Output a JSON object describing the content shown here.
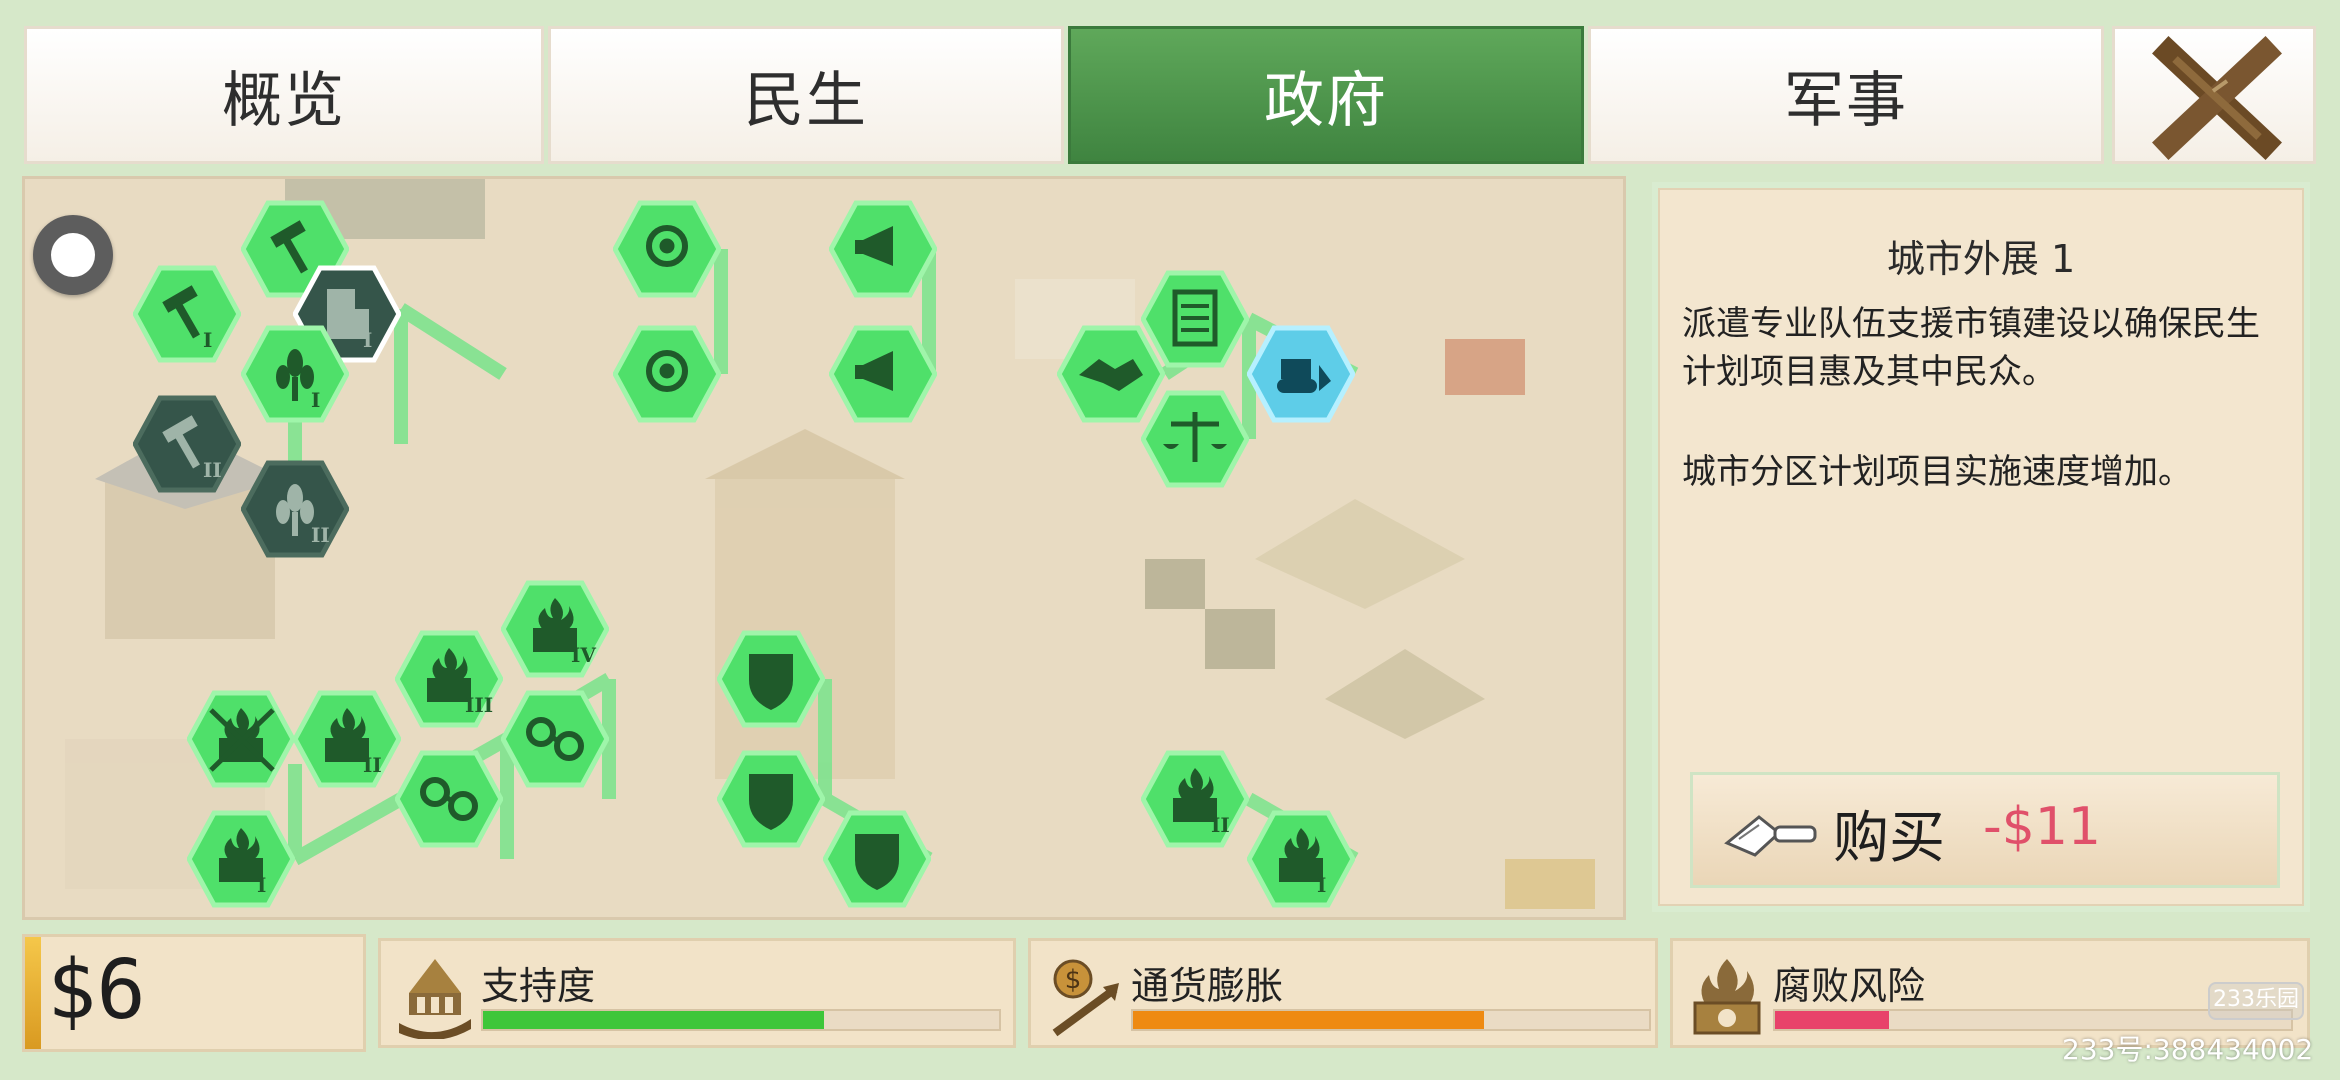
{
  "tabs": [
    {
      "label": "概览",
      "active": false
    },
    {
      "label": "民生",
      "active": false
    },
    {
      "label": "政府",
      "active": true
    },
    {
      "label": "军事",
      "active": false
    }
  ],
  "colors": {
    "active_tab": "#4a944a",
    "node_unlocked": "#4fe06a",
    "node_locked": "#35554a",
    "node_selected": "#5ecde8",
    "support_bar": "#3ec63a",
    "inflation_bar": "#ee8a12",
    "corruption_bar": "#e8426a",
    "price": "#e0506a"
  },
  "tech_nodes": [
    {
      "icon": "mountain-pick-1-icon",
      "state": "unlocked",
      "numeral": "I"
    },
    {
      "icon": "hammer-icon",
      "state": "unlocked",
      "numeral": ""
    },
    {
      "icon": "building-1-icon",
      "state": "locked-selected",
      "numeral": "I"
    },
    {
      "icon": "wheat-hammer-1-icon",
      "state": "unlocked",
      "numeral": "I"
    },
    {
      "icon": "mountain-pick-2-icon",
      "state": "locked",
      "numeral": "II"
    },
    {
      "icon": "wheat-2-icon",
      "state": "locked",
      "numeral": "II"
    },
    {
      "icon": "eye-icon",
      "state": "unlocked",
      "numeral": ""
    },
    {
      "icon": "eye-upgrade-icon",
      "state": "unlocked",
      "numeral": ""
    },
    {
      "icon": "megaphone-icon",
      "state": "unlocked",
      "numeral": ""
    },
    {
      "icon": "megaphone-star-icon",
      "state": "unlocked",
      "numeral": ""
    },
    {
      "icon": "handshake-icon",
      "state": "unlocked",
      "numeral": ""
    },
    {
      "icon": "checklist-icon",
      "state": "unlocked",
      "numeral": ""
    },
    {
      "icon": "scales-icon",
      "state": "unlocked",
      "numeral": ""
    },
    {
      "icon": "bulldozer-icon",
      "state": "selected",
      "numeral": ""
    },
    {
      "icon": "burning-money-4-icon",
      "state": "unlocked",
      "numeral": "IV"
    },
    {
      "icon": "burning-money-3-icon",
      "state": "unlocked",
      "numeral": "III"
    },
    {
      "icon": "burning-money-2-icon",
      "state": "unlocked",
      "numeral": "II"
    },
    {
      "icon": "burning-money-1-icon",
      "state": "unlocked",
      "numeral": "I"
    },
    {
      "icon": "crossed-money-icon",
      "state": "unlocked",
      "numeral": ""
    },
    {
      "icon": "handcuffs-down-icon",
      "state": "unlocked",
      "numeral": ""
    },
    {
      "icon": "handcuffs-arrest-icon",
      "state": "unlocked",
      "numeral": ""
    },
    {
      "icon": "shield-star-icon",
      "state": "unlocked",
      "numeral": ""
    },
    {
      "icon": "shield-icon",
      "state": "unlocked",
      "numeral": ""
    },
    {
      "icon": "shield-coin-icon",
      "state": "unlocked",
      "numeral": ""
    },
    {
      "icon": "briefcase-2-icon",
      "state": "unlocked",
      "numeral": "II"
    },
    {
      "icon": "briefcase-1-icon",
      "state": "unlocked",
      "numeral": "I"
    }
  ],
  "info_panel": {
    "title": "城市外展 1",
    "description": "派遣专业队伍支援市镇建设以确保民生计划项目惠及其中民众。",
    "effect": "城市分区计划项目实施速度增加。",
    "buy_label": "购买",
    "buy_price": "-$11"
  },
  "treasury": {
    "text": "$6"
  },
  "stats": [
    {
      "label": "支持度",
      "icon": "palace-hand-icon",
      "level": 0.66
    },
    {
      "label": "通货膨胀",
      "icon": "dollar-arrow-icon",
      "level": 0.68
    },
    {
      "label": "腐败风险",
      "icon": "burning-money-icon",
      "level": 0.22
    }
  ],
  "watermark": {
    "badge": "233乐园",
    "id": "233号:388434002"
  }
}
